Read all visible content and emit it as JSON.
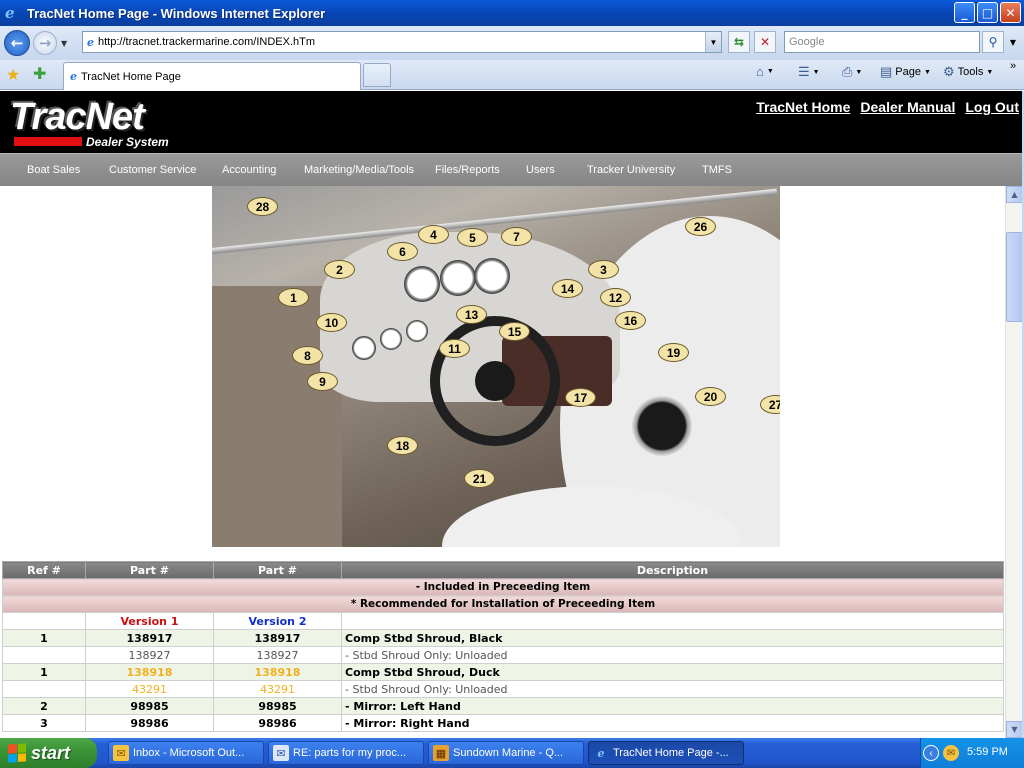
{
  "window": {
    "title": "TracNet Home Page - Windows Internet Explorer",
    "controls": {
      "minimize": "_",
      "maximize": "□",
      "close": "✕"
    }
  },
  "nav": {
    "back_icon": "back-arrow-icon",
    "forward_icon": "forward-arrow-icon",
    "address": "http://tracnet.trackermarine.com/INDEX.hTm",
    "search_placeholder": "Google"
  },
  "tabs": {
    "active_tab_label": "TracNet Home Page"
  },
  "command_bar": {
    "page_label": "Page",
    "tools_label": "Tools",
    "overflow": "»"
  },
  "site": {
    "logo_text": "TracNet",
    "logo_subtitle": "Dealer System",
    "top_links": [
      "TracNet Home",
      "Dealer Manual",
      "Log Out"
    ],
    "menu": [
      "Boat Sales",
      "Customer Service",
      "Accounting",
      "Marketing/Media/Tools",
      "Files/Reports",
      "Users",
      "Tracker University",
      "TMFS"
    ]
  },
  "diagram": {
    "callouts": [
      "1",
      "2",
      "3",
      "4",
      "5",
      "6",
      "7",
      "8",
      "9",
      "10",
      "11",
      "12",
      "13",
      "14",
      "15",
      "16",
      "17",
      "18",
      "19",
      "20",
      "21",
      "26",
      "27",
      "28"
    ]
  },
  "parts_table": {
    "headers": [
      "Ref #",
      "Part #",
      "Part #",
      "Description"
    ],
    "notes": [
      "- Included in Preceeding Item",
      "* Recommended for Installation of Preceeding Item"
    ],
    "version_labels": [
      "Version 1",
      "Version 2"
    ],
    "rows": [
      {
        "ref": "1",
        "v1": "138917",
        "v2": "138917",
        "desc": "Comp Stbd Shroud, Black"
      },
      {
        "ref": "",
        "v1": "138927",
        "v2": "138927",
        "desc": "- Stbd Shroud Only: Unloaded"
      },
      {
        "ref": "1",
        "v1": "138918",
        "v2": "138918",
        "desc": "Comp Stbd Shroud, Duck"
      },
      {
        "ref": "",
        "v1": "43291",
        "v2": "43291",
        "desc": "- Stbd Shroud Only: Unloaded"
      },
      {
        "ref": "2",
        "v1": "98985",
        "v2": "98985",
        "desc": "- Mirror: Left Hand"
      },
      {
        "ref": "3",
        "v1": "98986",
        "v2": "98986",
        "desc": "- Mirror: Right Hand"
      }
    ]
  },
  "taskbar": {
    "start_label": "start",
    "tasks": [
      "Inbox - Microsoft Out...",
      "RE: parts for my proc...",
      "Sundown Marine - Q...",
      "TracNet Home Page -..."
    ],
    "clock": "5:59 PM"
  },
  "colors": {
    "version1": "#c81010",
    "version2": "#1030c8",
    "highlight_part": "#f0b020"
  }
}
